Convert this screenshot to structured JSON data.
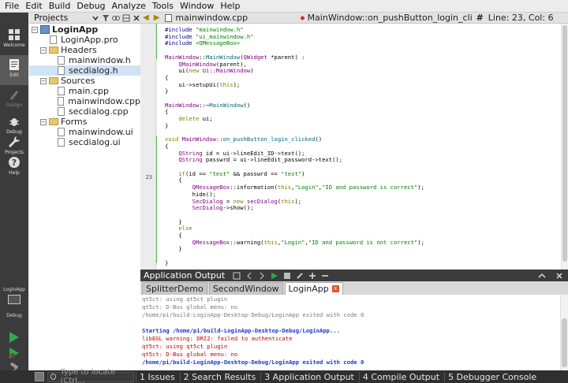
{
  "menubar": [
    "File",
    "Edit",
    "Build",
    "Debug",
    "Analyze",
    "Tools",
    "Window",
    "Help"
  ],
  "modes": [
    {
      "label": "Welcome",
      "icon": "grid-icon"
    },
    {
      "label": "Edit",
      "icon": "edit-icon"
    },
    {
      "label": "Design",
      "icon": "pen-icon"
    },
    {
      "label": "Debug",
      "icon": "bug-icon"
    },
    {
      "label": "Projects",
      "icon": "wrench-icon"
    },
    {
      "label": "Help",
      "icon": "help-icon"
    }
  ],
  "kit": {
    "project": "LoginApp",
    "mode": "Debug"
  },
  "projects": {
    "selector": "Projects",
    "tree": [
      {
        "label": "LoginApp",
        "level": 0,
        "kind": "project"
      },
      {
        "label": "LoginApp.pro",
        "level": 1,
        "kind": "file"
      },
      {
        "label": "Headers",
        "level": 1,
        "kind": "folder"
      },
      {
        "label": "mainwindow.h",
        "level": 2,
        "kind": "file"
      },
      {
        "label": "secdialog.h",
        "level": 2,
        "kind": "file",
        "selected": true
      },
      {
        "label": "Sources",
        "level": 1,
        "kind": "folder"
      },
      {
        "label": "main.cpp",
        "level": 2,
        "kind": "file"
      },
      {
        "label": "mainwindow.cpp",
        "level": 2,
        "kind": "file"
      },
      {
        "label": "secdialog.cpp",
        "level": 2,
        "kind": "file"
      },
      {
        "label": "Forms",
        "level": 1,
        "kind": "folder"
      },
      {
        "label": "mainwindow.ui",
        "level": 2,
        "kind": "file"
      },
      {
        "label": "secdialog.ui",
        "level": 2,
        "kind": "file"
      }
    ]
  },
  "editor": {
    "file": "mainwindow.cpp",
    "function": "MainWindow::on_pushButton_login_clicked(): v...",
    "hash": "#",
    "position": "Line: 23, Col: 6",
    "current_line": "23",
    "code": [
      [
        [
          "c-pp",
          "#include "
        ],
        [
          "c-str",
          "\"mainwindow.h\""
        ]
      ],
      [
        [
          "c-pp",
          "#include "
        ],
        [
          "c-str",
          "\"ui_mainwindow.h\""
        ]
      ],
      [
        [
          "c-pp",
          "#include "
        ],
        [
          "c-str",
          "<QMessageBox>"
        ]
      ],
      [],
      [
        [
          "c-cls",
          "MainWindow"
        ],
        [
          "c-nm",
          "::"
        ],
        [
          "c-fn",
          "MainWindow"
        ],
        [
          "c-nm",
          "("
        ],
        [
          "c-cls",
          "QWidget"
        ],
        [
          "c-nm",
          " *parent) :"
        ]
      ],
      [
        [
          "c-nm",
          "    "
        ],
        [
          "c-cls",
          "QMainWindow"
        ],
        [
          "c-nm",
          "(parent),"
        ]
      ],
      [
        [
          "c-nm",
          "    ui("
        ],
        [
          "c-kw",
          "new"
        ],
        [
          "c-nm",
          " "
        ],
        [
          "c-cls",
          "Ui::MainWindow"
        ],
        [
          "c-nm",
          ")"
        ]
      ],
      [
        [
          "c-nm",
          "{"
        ]
      ],
      [
        [
          "c-nm",
          "    ui->setupUi("
        ],
        [
          "c-kw",
          "this"
        ],
        [
          "c-nm",
          ");"
        ]
      ],
      [
        [
          "c-nm",
          "}"
        ]
      ],
      [],
      [
        [
          "c-cls",
          "MainWindow"
        ],
        [
          "c-nm",
          "::~"
        ],
        [
          "c-fn",
          "MainWindow"
        ],
        [
          "c-nm",
          "()"
        ]
      ],
      [
        [
          "c-nm",
          "{"
        ]
      ],
      [
        [
          "c-nm",
          "    "
        ],
        [
          "c-kw",
          "delete"
        ],
        [
          "c-nm",
          " ui;"
        ]
      ],
      [
        [
          "c-nm",
          "}"
        ]
      ],
      [],
      [
        [
          "c-kw",
          "void"
        ],
        [
          "c-nm",
          " "
        ],
        [
          "c-cls",
          "MainWindow"
        ],
        [
          "c-nm",
          "::"
        ],
        [
          "c-fn",
          "on_pushButton_login_clicked"
        ],
        [
          "c-nm",
          "()"
        ]
      ],
      [
        [
          "c-nm",
          "{"
        ]
      ],
      [
        [
          "c-nm",
          "    "
        ],
        [
          "c-cls",
          "QString"
        ],
        [
          "c-nm",
          " id = ui->lineEdit_ID->text();"
        ]
      ],
      [
        [
          "c-nm",
          "    "
        ],
        [
          "c-cls",
          "QString"
        ],
        [
          "c-nm",
          " passwrd = ui->lineEdit_password->text();"
        ]
      ],
      [],
      [
        [
          "c-nm",
          "    "
        ],
        [
          "c-kw",
          "if"
        ],
        [
          "c-nm",
          "(id == "
        ],
        [
          "c-str",
          "\"test\""
        ],
        [
          "c-nm",
          " && passwrd == "
        ],
        [
          "c-str",
          "\"test\""
        ],
        [
          "c-nm",
          ")"
        ]
      ],
      [
        [
          "c-nm",
          "    {"
        ]
      ],
      [
        [
          "c-nm",
          "        "
        ],
        [
          "c-cls",
          "QMessageBox"
        ],
        [
          "c-nm",
          "::information("
        ],
        [
          "c-kw",
          "this"
        ],
        [
          "c-nm",
          ","
        ],
        [
          "c-str",
          "\"Login\""
        ],
        [
          "c-nm",
          ","
        ],
        [
          "c-str",
          "\"ID and password is correct\""
        ],
        [
          "c-nm",
          ");"
        ]
      ],
      [
        [
          "c-nm",
          "        hide();"
        ]
      ],
      [
        [
          "c-nm",
          "        "
        ],
        [
          "c-cls",
          "SecDialog"
        ],
        [
          "c-nm",
          " = "
        ],
        [
          "c-kw",
          "new"
        ],
        [
          "c-nm",
          " "
        ],
        [
          "c-cls",
          "secDialog"
        ],
        [
          "c-nm",
          "("
        ],
        [
          "c-kw",
          "this"
        ],
        [
          "c-nm",
          ");"
        ]
      ],
      [
        [
          "c-nm",
          "        "
        ],
        [
          "c-cls",
          "SecDialog"
        ],
        [
          "c-nm",
          "->show();"
        ]
      ],
      [],
      [
        [
          "c-nm",
          "    }"
        ]
      ],
      [
        [
          "c-nm",
          "    "
        ],
        [
          "c-kw",
          "else"
        ]
      ],
      [
        [
          "c-nm",
          "    {"
        ]
      ],
      [
        [
          "c-nm",
          "        "
        ],
        [
          "c-cls",
          "QMessageBox"
        ],
        [
          "c-nm",
          "::warning("
        ],
        [
          "c-kw",
          "this"
        ],
        [
          "c-nm",
          ","
        ],
        [
          "c-str",
          "\"Login\""
        ],
        [
          "c-nm",
          ","
        ],
        [
          "c-str",
          "\"ID and password is not correct\""
        ],
        [
          "c-nm",
          ");"
        ]
      ],
      [
        [
          "c-nm",
          "    }"
        ]
      ],
      [],
      [
        [
          "c-nm",
          "}"
        ]
      ]
    ]
  },
  "output": {
    "title": "Application Output",
    "tabs": [
      {
        "label": "SplitterDemo",
        "active": false
      },
      {
        "label": "SecondWindow",
        "active": false
      },
      {
        "label": "LoginApp",
        "active": true,
        "closable": true
      }
    ],
    "close_glyph": "x",
    "lines": [
      [
        "o-gray",
        "qt5ct: using qt5ct plugin"
      ],
      [
        "o-gray",
        "qt5ct: D-Bus global menu: no"
      ],
      [
        "o-gray",
        "/home/pi/build-LoginApp-Desktop-Debug/LoginApp exited with code 0"
      ],
      [
        "o-gray",
        ""
      ],
      [
        "o-blue",
        "Starting /home/pi/build-LoginApp-Desktop-Debug/LoginApp..."
      ],
      [
        "o-red",
        "libEGL warning: DRI2: failed to authenticate"
      ],
      [
        "o-red",
        "qt5ct: using qt5ct plugin"
      ],
      [
        "o-red",
        "qt5ct: D-Bus global menu: no"
      ],
      [
        "o-blue",
        "/home/pi/build-LoginApp-Desktop-Debug/LoginApp exited with code 0"
      ]
    ]
  },
  "statusbar": {
    "locate_placeholder": "Type to locate (Ctrl...",
    "panes": [
      "1 Issues",
      "2 Search Results",
      "3 Application Output",
      "4 Compile Output",
      "5 Debugger Console"
    ]
  },
  "colors": {
    "run_green": "#2fa84f",
    "active_tab_close": "#e0542d"
  }
}
